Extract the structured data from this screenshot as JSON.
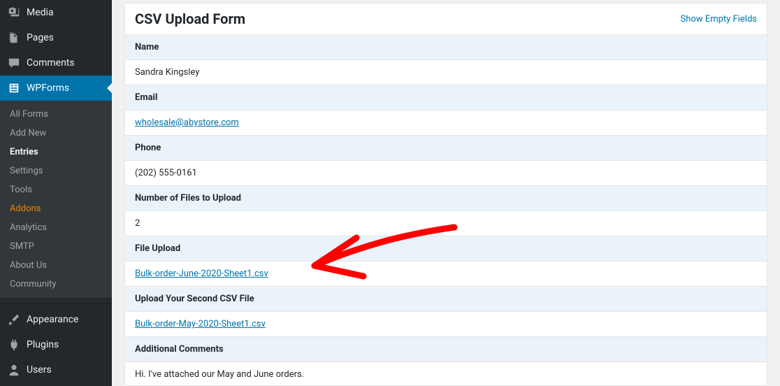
{
  "sidebar": {
    "top": [
      {
        "label": "Media",
        "icon": "media"
      },
      {
        "label": "Pages",
        "icon": "pages"
      },
      {
        "label": "Comments",
        "icon": "comment"
      }
    ],
    "wpforms": {
      "label": "WPForms",
      "icon": "form"
    },
    "sub": [
      {
        "label": "All Forms"
      },
      {
        "label": "Add New"
      },
      {
        "label": "Entries",
        "current": true
      },
      {
        "label": "Settings"
      },
      {
        "label": "Tools"
      },
      {
        "label": "Addons",
        "addons": true
      },
      {
        "label": "Analytics"
      },
      {
        "label": "SMTP"
      },
      {
        "label": "About Us"
      },
      {
        "label": "Community"
      }
    ],
    "bottom": [
      {
        "label": "Appearance",
        "icon": "brush"
      },
      {
        "label": "Plugins",
        "icon": "plug"
      },
      {
        "label": "Users",
        "icon": "user"
      }
    ]
  },
  "panel": {
    "title": "CSV Upload Form",
    "emptyLink": "Show Empty Fields",
    "fields": {
      "name": {
        "label": "Name",
        "value": "Sandra Kingsley"
      },
      "email": {
        "label": "Email",
        "value": "wholesale@abystore.com",
        "link": true
      },
      "phone": {
        "label": "Phone",
        "value": "(202) 555-0161"
      },
      "numfiles": {
        "label": "Number of Files to Upload",
        "value": "2"
      },
      "upload1": {
        "label": "File Upload",
        "value": "Bulk-order-June-2020-Sheet1.csv",
        "link": true
      },
      "upload2": {
        "label": "Upload Your Second CSV File",
        "value": "Bulk-order-May-2020-Sheet1.csv",
        "link": true
      },
      "comments": {
        "label": "Additional Comments",
        "value": "Hi. I've attached our May and June orders."
      }
    }
  }
}
